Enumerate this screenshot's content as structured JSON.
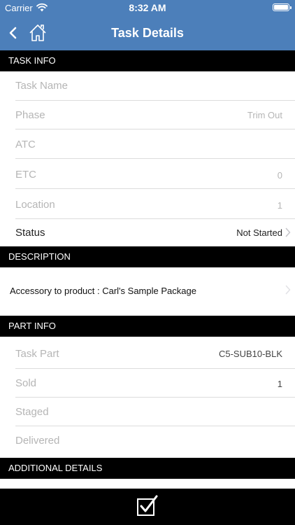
{
  "status_bar": {
    "carrier": "Carrier",
    "time": "8:32 AM"
  },
  "nav": {
    "title": "Task Details"
  },
  "task_info": {
    "header": "TASK INFO",
    "task_name": {
      "label": "Task Name",
      "value": ""
    },
    "phase": {
      "label": "Phase",
      "value": "Trim Out"
    },
    "atc": {
      "label": "ATC",
      "value": ""
    },
    "etc": {
      "label": "ETC",
      "value": "0"
    },
    "location": {
      "label": "Location",
      "value": "1"
    },
    "status": {
      "label": "Status",
      "value": "Not Started"
    }
  },
  "description": {
    "header": "DESCRIPTION",
    "text": "Accessory to product :   Carl's Sample Package"
  },
  "part_info": {
    "header": "PART INFO",
    "task_part": {
      "label": "Task Part",
      "value": "C5-SUB10-BLK"
    },
    "sold": {
      "label": "Sold",
      "value": "1"
    },
    "staged": {
      "label": "Staged",
      "value": ""
    },
    "delivered": {
      "label": "Delivered",
      "value": ""
    }
  },
  "additional": {
    "header": "ADDITIONAL DETAILS"
  },
  "icons": {
    "back": "chevron-left-icon",
    "home": "home-icon",
    "save": "checkbox-check-icon",
    "wifi": "wifi-icon",
    "battery": "battery-icon"
  }
}
